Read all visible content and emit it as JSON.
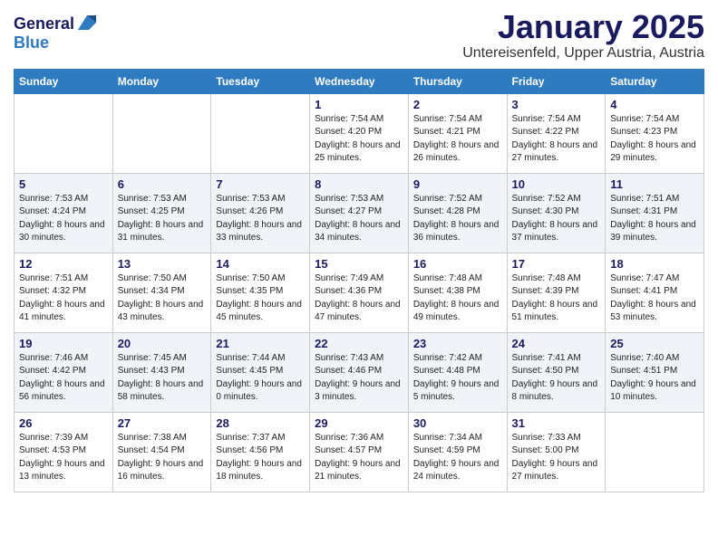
{
  "header": {
    "logo_general": "General",
    "logo_blue": "Blue",
    "month_title": "January 2025",
    "location": "Untereisenfeld, Upper Austria, Austria"
  },
  "weekdays": [
    "Sunday",
    "Monday",
    "Tuesday",
    "Wednesday",
    "Thursday",
    "Friday",
    "Saturday"
  ],
  "weeks": [
    [
      {
        "day": "",
        "sunrise": "",
        "sunset": "",
        "daylight": ""
      },
      {
        "day": "",
        "sunrise": "",
        "sunset": "",
        "daylight": ""
      },
      {
        "day": "",
        "sunrise": "",
        "sunset": "",
        "daylight": ""
      },
      {
        "day": "1",
        "sunrise": "Sunrise: 7:54 AM",
        "sunset": "Sunset: 4:20 PM",
        "daylight": "Daylight: 8 hours and 25 minutes."
      },
      {
        "day": "2",
        "sunrise": "Sunrise: 7:54 AM",
        "sunset": "Sunset: 4:21 PM",
        "daylight": "Daylight: 8 hours and 26 minutes."
      },
      {
        "day": "3",
        "sunrise": "Sunrise: 7:54 AM",
        "sunset": "Sunset: 4:22 PM",
        "daylight": "Daylight: 8 hours and 27 minutes."
      },
      {
        "day": "4",
        "sunrise": "Sunrise: 7:54 AM",
        "sunset": "Sunset: 4:23 PM",
        "daylight": "Daylight: 8 hours and 29 minutes."
      }
    ],
    [
      {
        "day": "5",
        "sunrise": "Sunrise: 7:53 AM",
        "sunset": "Sunset: 4:24 PM",
        "daylight": "Daylight: 8 hours and 30 minutes."
      },
      {
        "day": "6",
        "sunrise": "Sunrise: 7:53 AM",
        "sunset": "Sunset: 4:25 PM",
        "daylight": "Daylight: 8 hours and 31 minutes."
      },
      {
        "day": "7",
        "sunrise": "Sunrise: 7:53 AM",
        "sunset": "Sunset: 4:26 PM",
        "daylight": "Daylight: 8 hours and 33 minutes."
      },
      {
        "day": "8",
        "sunrise": "Sunrise: 7:53 AM",
        "sunset": "Sunset: 4:27 PM",
        "daylight": "Daylight: 8 hours and 34 minutes."
      },
      {
        "day": "9",
        "sunrise": "Sunrise: 7:52 AM",
        "sunset": "Sunset: 4:28 PM",
        "daylight": "Daylight: 8 hours and 36 minutes."
      },
      {
        "day": "10",
        "sunrise": "Sunrise: 7:52 AM",
        "sunset": "Sunset: 4:30 PM",
        "daylight": "Daylight: 8 hours and 37 minutes."
      },
      {
        "day": "11",
        "sunrise": "Sunrise: 7:51 AM",
        "sunset": "Sunset: 4:31 PM",
        "daylight": "Daylight: 8 hours and 39 minutes."
      }
    ],
    [
      {
        "day": "12",
        "sunrise": "Sunrise: 7:51 AM",
        "sunset": "Sunset: 4:32 PM",
        "daylight": "Daylight: 8 hours and 41 minutes."
      },
      {
        "day": "13",
        "sunrise": "Sunrise: 7:50 AM",
        "sunset": "Sunset: 4:34 PM",
        "daylight": "Daylight: 8 hours and 43 minutes."
      },
      {
        "day": "14",
        "sunrise": "Sunrise: 7:50 AM",
        "sunset": "Sunset: 4:35 PM",
        "daylight": "Daylight: 8 hours and 45 minutes."
      },
      {
        "day": "15",
        "sunrise": "Sunrise: 7:49 AM",
        "sunset": "Sunset: 4:36 PM",
        "daylight": "Daylight: 8 hours and 47 minutes."
      },
      {
        "day": "16",
        "sunrise": "Sunrise: 7:48 AM",
        "sunset": "Sunset: 4:38 PM",
        "daylight": "Daylight: 8 hours and 49 minutes."
      },
      {
        "day": "17",
        "sunrise": "Sunrise: 7:48 AM",
        "sunset": "Sunset: 4:39 PM",
        "daylight": "Daylight: 8 hours and 51 minutes."
      },
      {
        "day": "18",
        "sunrise": "Sunrise: 7:47 AM",
        "sunset": "Sunset: 4:41 PM",
        "daylight": "Daylight: 8 hours and 53 minutes."
      }
    ],
    [
      {
        "day": "19",
        "sunrise": "Sunrise: 7:46 AM",
        "sunset": "Sunset: 4:42 PM",
        "daylight": "Daylight: 8 hours and 56 minutes."
      },
      {
        "day": "20",
        "sunrise": "Sunrise: 7:45 AM",
        "sunset": "Sunset: 4:43 PM",
        "daylight": "Daylight: 8 hours and 58 minutes."
      },
      {
        "day": "21",
        "sunrise": "Sunrise: 7:44 AM",
        "sunset": "Sunset: 4:45 PM",
        "daylight": "Daylight: 9 hours and 0 minutes."
      },
      {
        "day": "22",
        "sunrise": "Sunrise: 7:43 AM",
        "sunset": "Sunset: 4:46 PM",
        "daylight": "Daylight: 9 hours and 3 minutes."
      },
      {
        "day": "23",
        "sunrise": "Sunrise: 7:42 AM",
        "sunset": "Sunset: 4:48 PM",
        "daylight": "Daylight: 9 hours and 5 minutes."
      },
      {
        "day": "24",
        "sunrise": "Sunrise: 7:41 AM",
        "sunset": "Sunset: 4:50 PM",
        "daylight": "Daylight: 9 hours and 8 minutes."
      },
      {
        "day": "25",
        "sunrise": "Sunrise: 7:40 AM",
        "sunset": "Sunset: 4:51 PM",
        "daylight": "Daylight: 9 hours and 10 minutes."
      }
    ],
    [
      {
        "day": "26",
        "sunrise": "Sunrise: 7:39 AM",
        "sunset": "Sunset: 4:53 PM",
        "daylight": "Daylight: 9 hours and 13 minutes."
      },
      {
        "day": "27",
        "sunrise": "Sunrise: 7:38 AM",
        "sunset": "Sunset: 4:54 PM",
        "daylight": "Daylight: 9 hours and 16 minutes."
      },
      {
        "day": "28",
        "sunrise": "Sunrise: 7:37 AM",
        "sunset": "Sunset: 4:56 PM",
        "daylight": "Daylight: 9 hours and 18 minutes."
      },
      {
        "day": "29",
        "sunrise": "Sunrise: 7:36 AM",
        "sunset": "Sunset: 4:57 PM",
        "daylight": "Daylight: 9 hours and 21 minutes."
      },
      {
        "day": "30",
        "sunrise": "Sunrise: 7:34 AM",
        "sunset": "Sunset: 4:59 PM",
        "daylight": "Daylight: 9 hours and 24 minutes."
      },
      {
        "day": "31",
        "sunrise": "Sunrise: 7:33 AM",
        "sunset": "Sunset: 5:00 PM",
        "daylight": "Daylight: 9 hours and 27 minutes."
      },
      {
        "day": "",
        "sunrise": "",
        "sunset": "",
        "daylight": ""
      }
    ]
  ]
}
